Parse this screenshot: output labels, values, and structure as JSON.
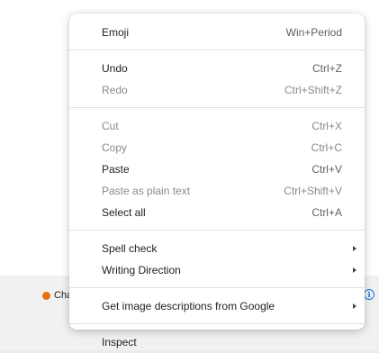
{
  "background": {
    "status_label": "Cha",
    "status_dot_color": "#e8710a",
    "info_icon": "info-icon"
  },
  "context_menu": {
    "items": [
      {
        "label": "Emoji",
        "shortcut": "Win+Period",
        "enabled": true
      },
      {
        "label": "Undo",
        "shortcut": "Ctrl+Z",
        "enabled": true
      },
      {
        "label": "Redo",
        "shortcut": "Ctrl+Shift+Z",
        "enabled": false
      },
      {
        "label": "Cut",
        "shortcut": "Ctrl+X",
        "enabled": false
      },
      {
        "label": "Copy",
        "shortcut": "Ctrl+C",
        "enabled": false
      },
      {
        "label": "Paste",
        "shortcut": "Ctrl+V",
        "enabled": true
      },
      {
        "label": "Paste as plain text",
        "shortcut": "Ctrl+Shift+V",
        "enabled": false
      },
      {
        "label": "Select all",
        "shortcut": "Ctrl+A",
        "enabled": true
      },
      {
        "label": "Spell check",
        "submenu_icon": "chevron-right-icon",
        "enabled": true
      },
      {
        "label": "Writing Direction",
        "submenu_icon": "chevron-right-icon",
        "enabled": true
      },
      {
        "label": "Get image descriptions from Google",
        "submenu_icon": "chevron-right-icon",
        "enabled": true
      },
      {
        "label": "Inspect",
        "enabled": true
      }
    ]
  }
}
